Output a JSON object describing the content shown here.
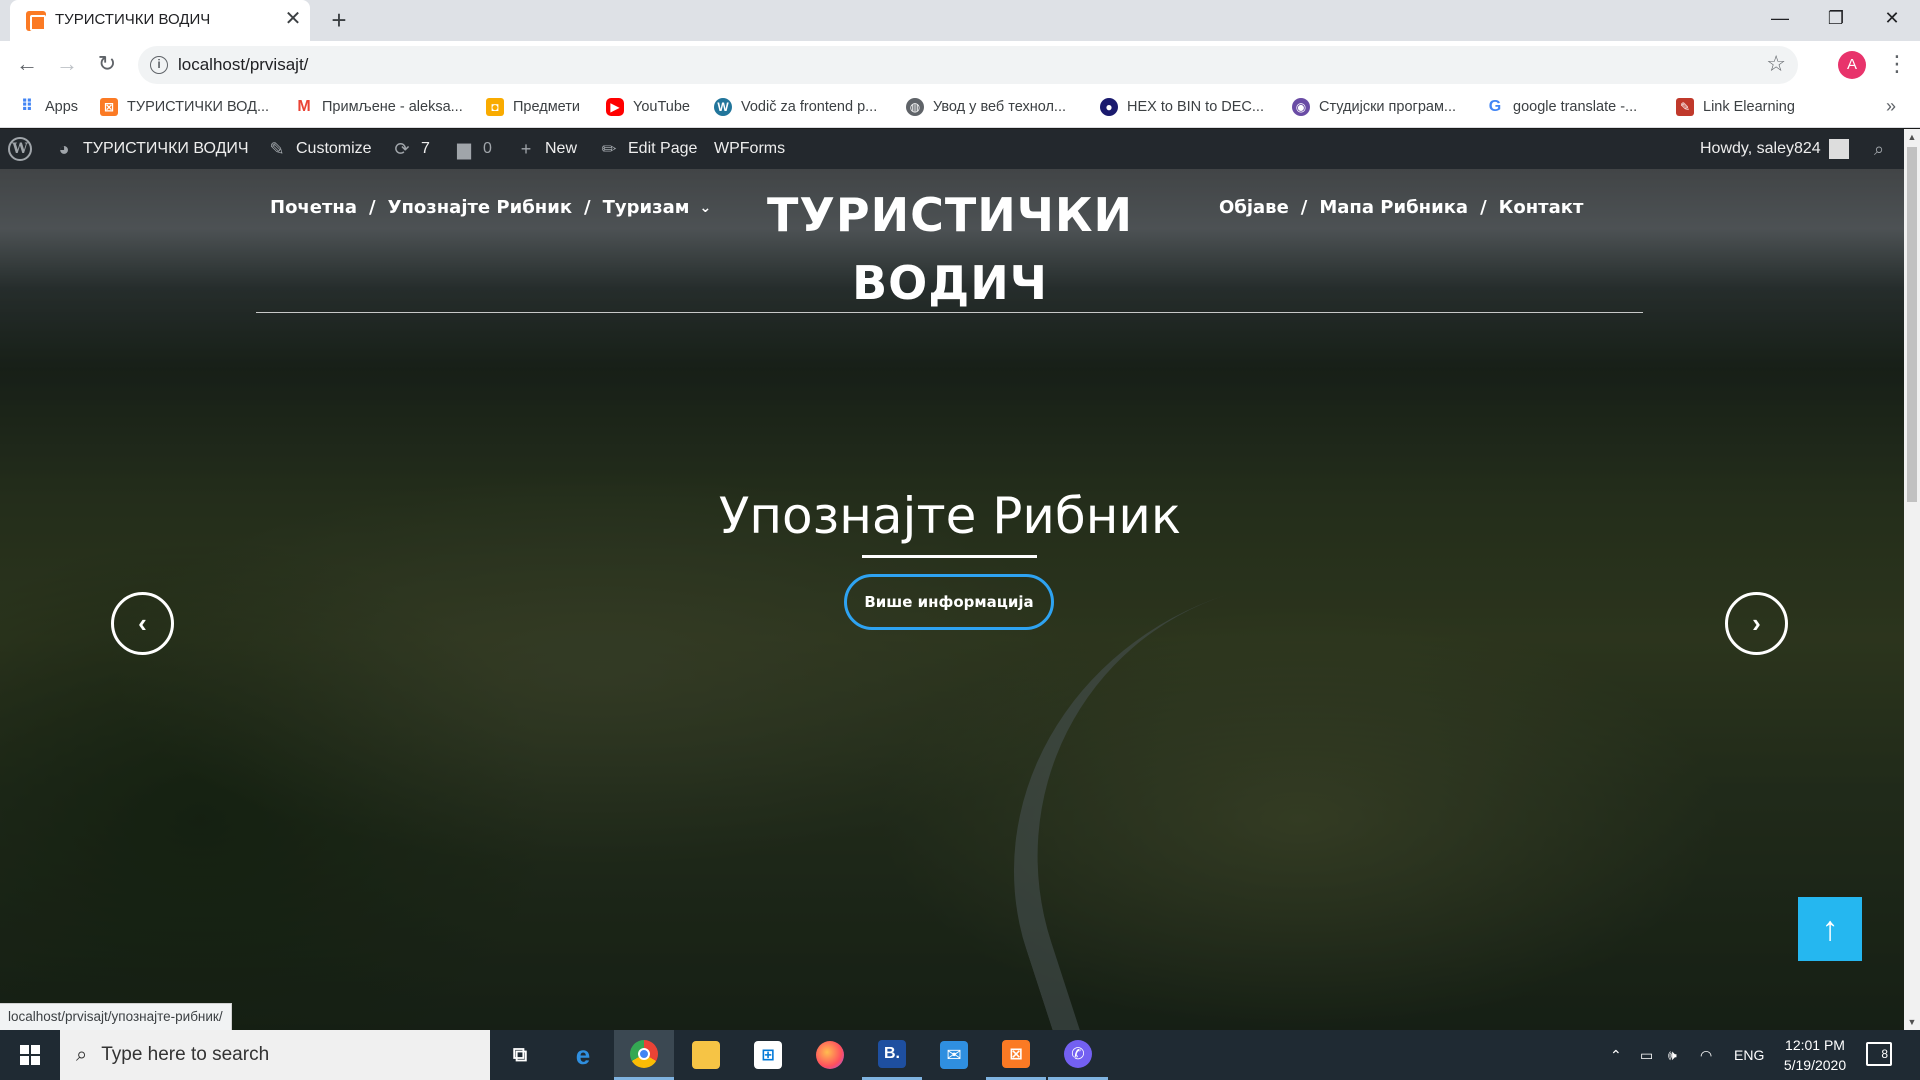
{
  "browser": {
    "tab_title": "ТУРИСТИЧКИ ВОДИЧ",
    "tab_close": "✕",
    "new_tab": "+",
    "url": "localhost/prvisajt/",
    "avatar_letter": "A",
    "window_controls": {
      "minimize": "—",
      "maximize": "❐",
      "close": "✕"
    }
  },
  "bookmarks": [
    {
      "label": "Apps",
      "icon": "apps-grid-icon",
      "color": "#4285f4"
    },
    {
      "label": "ТУРИСТИЧКИ ВОД...",
      "icon": "xampp-icon",
      "color": "#fb7a24"
    },
    {
      "label": "Примљене - aleksa...",
      "icon": "gmail-icon",
      "color": "#ea4335"
    },
    {
      "label": "Предмети",
      "icon": "classroom-icon",
      "color": "#1e8e3e"
    },
    {
      "label": "YouTube",
      "icon": "youtube-icon",
      "color": "#ff0000"
    },
    {
      "label": "Vodič za frontend p...",
      "icon": "wordpress-icon",
      "color": "#21759b"
    },
    {
      "label": "Увод у веб технол...",
      "icon": "globe-icon",
      "color": "#5f6368"
    },
    {
      "label": "HEX to BIN to DEC...",
      "icon": "hex-converter-icon",
      "color": "#1a1a6e"
    },
    {
      "label": "Студијски програм...",
      "icon": "university-icon",
      "color": "#6a4ca5"
    },
    {
      "label": "google translate -...",
      "icon": "google-icon",
      "color": "#4285f4"
    },
    {
      "label": "Link Elearning",
      "icon": "elearning-icon",
      "color": "#c0392b"
    }
  ],
  "adminbar": {
    "site_name": "ТУРИСТИЧКИ ВОДИЧ",
    "customize": "Customize",
    "updates_count": "7",
    "comments_count": "0",
    "new": "New",
    "edit_page": "Edit Page",
    "wpforms": "WPForms",
    "howdy": "Howdy, saley824"
  },
  "site": {
    "title": "ТУРИСТИЧКИ ВОДИЧ",
    "nav_left": [
      "Почетна",
      "Упознајте Рибник",
      "Туризам"
    ],
    "nav_right": [
      "Објаве",
      "Мапа Рибника",
      "Контакт"
    ],
    "nav_separator": "/",
    "slide_title": "Упознајте Рибник",
    "slide_button": "Више информација",
    "prev_arrow": "‹",
    "next_arrow": "›",
    "to_top": "↑",
    "accent_color": "#2ea3f2"
  },
  "status_bar": {
    "hover_url": "localhost/prvisajt/упознајте-рибник/"
  },
  "taskbar": {
    "search_placeholder": "Type here to search",
    "language": "ENG",
    "time": "12:01 PM",
    "date": "5/19/2020",
    "notifications": "8"
  }
}
